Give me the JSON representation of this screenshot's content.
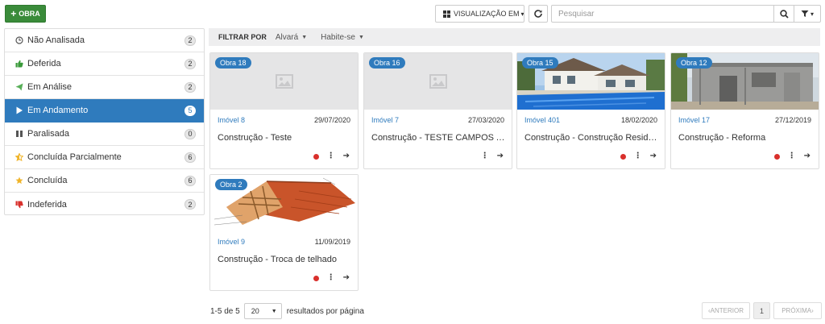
{
  "toolbar": {
    "new_button": "OBRA",
    "view_button": "VISUALIZAÇÃO EM",
    "search_placeholder": "Pesquisar"
  },
  "sidebar": {
    "items": [
      {
        "label": "Não Analisada",
        "count": "2",
        "icon": "clock-icon",
        "color": "#555555"
      },
      {
        "label": "Deferida",
        "count": "2",
        "icon": "thumbs-up-icon",
        "color": "#3a9a3a"
      },
      {
        "label": "Em Análise",
        "count": "2",
        "icon": "paper-plane-icon",
        "color": "#5ab05a"
      },
      {
        "label": "Em Andamento",
        "count": "5",
        "icon": "play-icon",
        "color": "#ffffff",
        "active": true
      },
      {
        "label": "Paralisada",
        "count": "0",
        "icon": "pause-icon",
        "color": "#555555"
      },
      {
        "label": "Concluída Parcialmente",
        "count": "6",
        "icon": "star-half-icon",
        "color": "#f0b429"
      },
      {
        "label": "Concluída",
        "count": "6",
        "icon": "star-icon",
        "color": "#f0b429"
      },
      {
        "label": "Indeferida",
        "count": "2",
        "icon": "thumbs-down-icon",
        "color": "#d9302c"
      }
    ]
  },
  "filters": {
    "label": "FILTRAR POR",
    "options": [
      "Alvará",
      "Habite-se"
    ]
  },
  "cards": [
    {
      "tag": "Obra 18",
      "imovel": "Imóvel 8",
      "date": "29/07/2020",
      "title": "Construção - Teste",
      "image": "placeholder",
      "has_red_dot": true
    },
    {
      "tag": "Obra 16",
      "imovel": "Imóvel 7",
      "date": "27/03/2020",
      "title": "Construção - TESTE CAMPOS ADICIONAIS",
      "image": "placeholder",
      "has_red_dot": false
    },
    {
      "tag": "Obra 15",
      "imovel": "Imóvel 401",
      "date": "18/02/2020",
      "title": "Construção - Construção Residencial",
      "image": "house-pool-photo",
      "has_red_dot": true
    },
    {
      "tag": "Obra 12",
      "imovel": "Imóvel 17",
      "date": "27/12/2019",
      "title": "Construção - Reforma",
      "image": "construction-photo",
      "has_red_dot": true
    },
    {
      "tag": "Obra 2",
      "imovel": "Imóvel 9",
      "date": "11/09/2019",
      "title": "Construção - Troca de telhado",
      "image": "roof-diagram",
      "has_red_dot": true
    }
  ],
  "pagination": {
    "range": "1-5 de 5",
    "page_size": "20",
    "per_page_label": "resultados por página",
    "prev": "ANTERIOR",
    "current": "1",
    "next": "PRÓXIMA"
  }
}
